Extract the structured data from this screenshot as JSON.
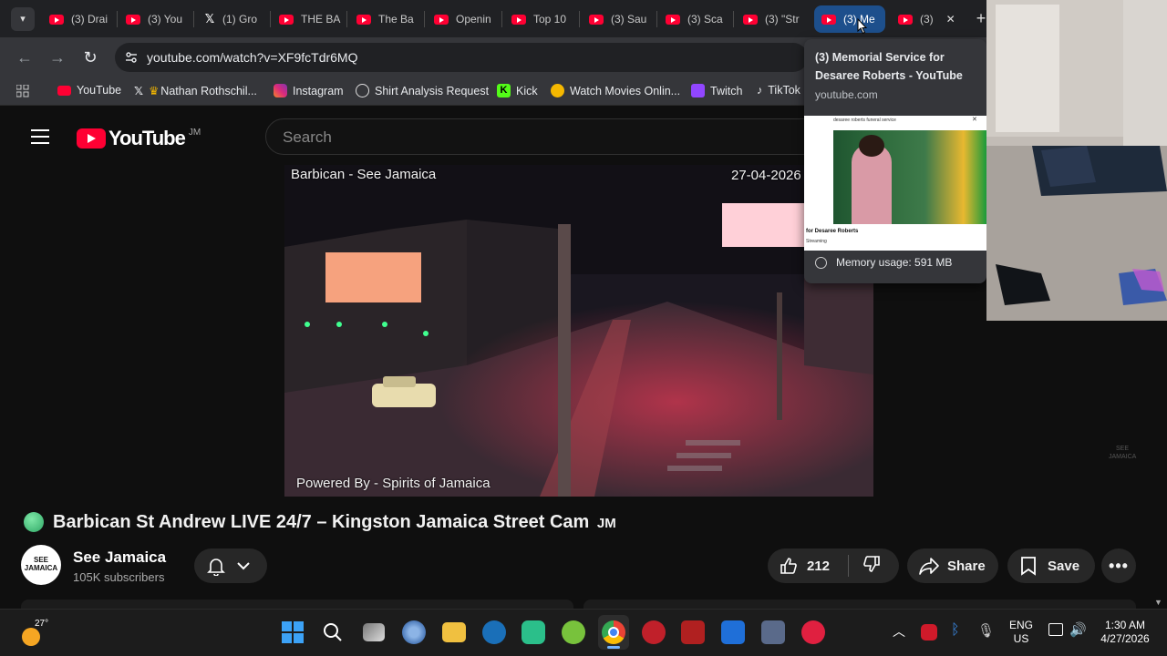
{
  "tabs": [
    {
      "label": "(3) Drai",
      "icon": "youtube-icon"
    },
    {
      "label": "(3) You",
      "icon": "youtube-icon"
    },
    {
      "label": "(1) Gro",
      "icon": "x-icon"
    },
    {
      "label": "THE BA",
      "icon": "youtube-icon"
    },
    {
      "label": "The Ba",
      "icon": "youtube-icon"
    },
    {
      "label": "Openin",
      "icon": "youtube-icon"
    },
    {
      "label": "Top 10",
      "icon": "youtube-icon"
    },
    {
      "label": "(3) Sau",
      "icon": "youtube-icon"
    },
    {
      "label": "(3) Sca",
      "icon": "youtube-icon"
    },
    {
      "label": "(3) \"Str",
      "icon": "youtube-icon"
    },
    {
      "label": "(3) Me",
      "icon": "youtube-icon",
      "active": true
    },
    {
      "label": "(3)",
      "icon": "youtube-icon"
    }
  ],
  "address_bar": {
    "url": "youtube.com/watch?v=XF9fcTdr6MQ"
  },
  "bookmarks": [
    {
      "label": "YouTube",
      "color": "#ff0033"
    },
    {
      "label": "Nathan Rothschil...",
      "color": "#ffffff"
    },
    {
      "label": "Instagram",
      "color": "#e1306c"
    },
    {
      "label": "Shirt Analysis Request",
      "color": "#ffffff"
    },
    {
      "label": "Kick",
      "color": "#53fc18"
    },
    {
      "label": "Watch Movies Onlin...",
      "color": "#f5b800"
    },
    {
      "label": "Twitch",
      "color": "#9146ff"
    },
    {
      "label": "TikTok",
      "color": "#ffffff"
    }
  ],
  "youtube": {
    "logo_text": "YouTube",
    "country_code": "JM",
    "search_placeholder": "Search"
  },
  "video": {
    "overlay_title": "Barbican - See Jamaica",
    "overlay_date": "27-04-2026",
    "overlay_footer": "Powered By - Spirits of Jamaica",
    "watermark": "SEE JAMAICA"
  },
  "video_info": {
    "title": "Barbican St Andrew LIVE 24/7 – Kingston Jamaica Street Cam",
    "title_suffix": "JM",
    "channel_name": "See Jamaica",
    "channel_avatar_text": "SEE JAMAICA",
    "subscribers": "105K subscribers",
    "likes": "212",
    "share_label": "Share",
    "save_label": "Save"
  },
  "hover_card": {
    "title": "(3) Memorial Service for Desaree Roberts - YouTube",
    "domain": "youtube.com",
    "thumb_header": "desaree roberts funeral service",
    "thumb_caption": "for Desaree Roberts",
    "thumb_sub": "Streaming",
    "memory": "Memory usage: 591 MB"
  },
  "taskbar": {
    "weather_temp": "27°",
    "language": "ENG",
    "region": "US",
    "time": "1:30 AM",
    "date": "4/27/2026"
  },
  "colors": {
    "accent_red": "#ff0033",
    "active_tab": "#1d4f8c",
    "bg": "#0f0f0f"
  }
}
